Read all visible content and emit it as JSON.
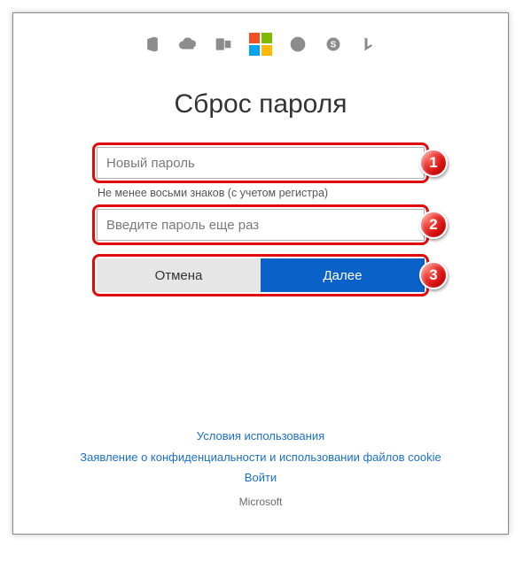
{
  "icons": {
    "office": "office-icon",
    "onedrive": "onedrive-icon",
    "outlook": "outlook-icon",
    "microsoft": "microsoft-logo-icon",
    "xbox": "xbox-icon",
    "skype": "skype-icon",
    "bing": "bing-icon"
  },
  "ms_logo_colors": {
    "tl": "#f25022",
    "tr": "#7fba00",
    "bl": "#00a4ef",
    "br": "#ffb900"
  },
  "title": "Сброс пароля",
  "form": {
    "new_password_placeholder": "Новый пароль",
    "hint": "Не менее восьми знаков (с учетом регистра)",
    "confirm_password_placeholder": "Введите пароль еще раз",
    "cancel_label": "Отмена",
    "next_label": "Далее"
  },
  "badges": {
    "one": "1",
    "two": "2",
    "three": "3"
  },
  "footer": {
    "terms": "Условия использования",
    "privacy": "Заявление о конфиденциальности и использовании файлов cookie",
    "signin": "Войти",
    "brand": "Microsoft"
  }
}
